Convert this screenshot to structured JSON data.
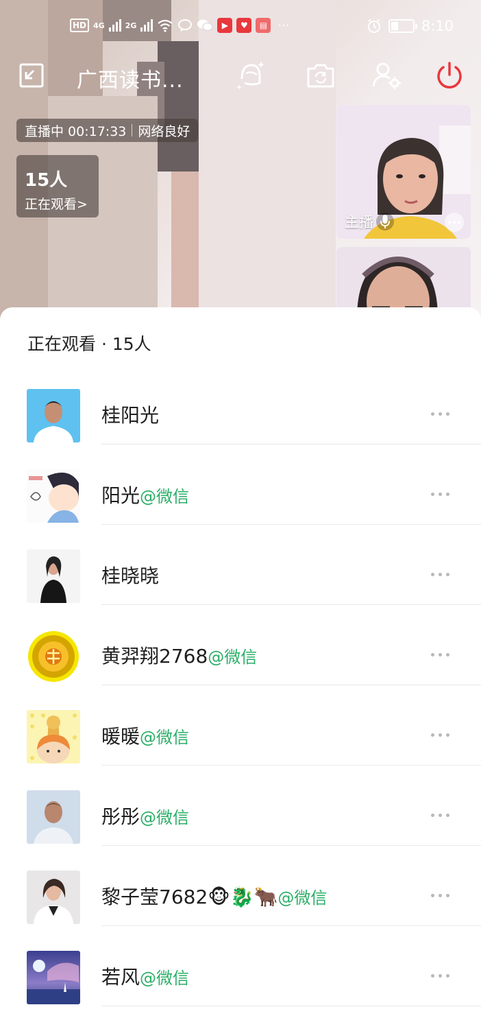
{
  "status_bar": {
    "hd": "HD",
    "sim1": "4G",
    "sim2": "2G",
    "time": "8:10",
    "battery_level": 0.3,
    "app_icons": [
      "video-app-icon",
      "weibo-app-icon",
      "book-app-icon"
    ],
    "more": "···"
  },
  "top_bar": {
    "title": "广西读书...",
    "icons": [
      "minimize-window-icon",
      "beauty-filter-icon",
      "switch-camera-icon",
      "member-settings-icon",
      "power-icon"
    ],
    "power_color": "#e8383d"
  },
  "live": {
    "status": "直播中 00:17:33",
    "network": "网络良好",
    "viewer_count": "15人",
    "viewer_link": "正在观看>"
  },
  "host_thumbs": {
    "label": "主播"
  },
  "sheet": {
    "title": "正在观看 · 15人",
    "viewers": [
      {
        "name": "桂阳光",
        "tag": ""
      },
      {
        "name": "阳光",
        "tag": "@微信"
      },
      {
        "name": "桂晓晓",
        "tag": ""
      },
      {
        "name": "黄羿翔2768",
        "tag": "@微信"
      },
      {
        "name": "暖暖",
        "tag": "@微信"
      },
      {
        "name": "彤彤",
        "tag": "@微信"
      },
      {
        "name": "黎子莹7682🐵🐉🐂",
        "tag": "@微信"
      },
      {
        "name": "若风",
        "tag": "@微信"
      }
    ]
  },
  "colors": {
    "wechat_green": "#2aae67",
    "overlay": "#463e3a"
  }
}
